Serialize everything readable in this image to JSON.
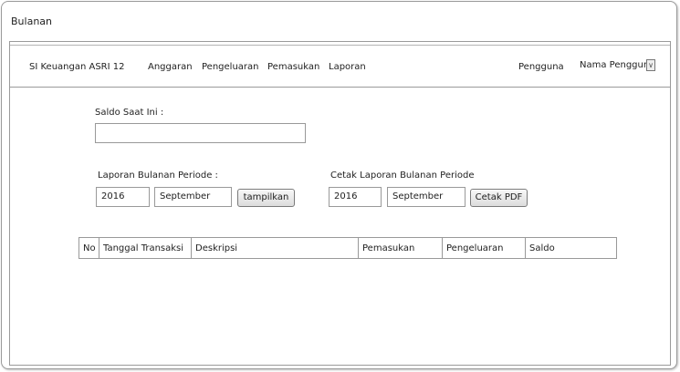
{
  "window": {
    "title": "Bulanan"
  },
  "navbar": {
    "app_name": "SI Keuangan ASRI 12",
    "items": [
      "Anggaran",
      "Pengeluaran",
      "Pemasukan",
      "Laporan"
    ],
    "user_label": "Pengguna",
    "user_select": {
      "value": "Nama Pengguna"
    }
  },
  "saldo": {
    "label": "Saldo Saat Ini :",
    "value": ""
  },
  "laporan": {
    "label": "Laporan Bulanan Periode :",
    "year": "2016",
    "month": "September",
    "button": "tampilkan"
  },
  "cetak": {
    "label": "Cetak Laporan Bulanan Periode",
    "year": "2016",
    "month": "September",
    "button": "Cetak PDF"
  },
  "table": {
    "headers": [
      "No",
      "Tanggal Transaksi",
      "Deskripsi",
      "Pemasukan",
      "Pengeluaran",
      "Saldo"
    ]
  }
}
